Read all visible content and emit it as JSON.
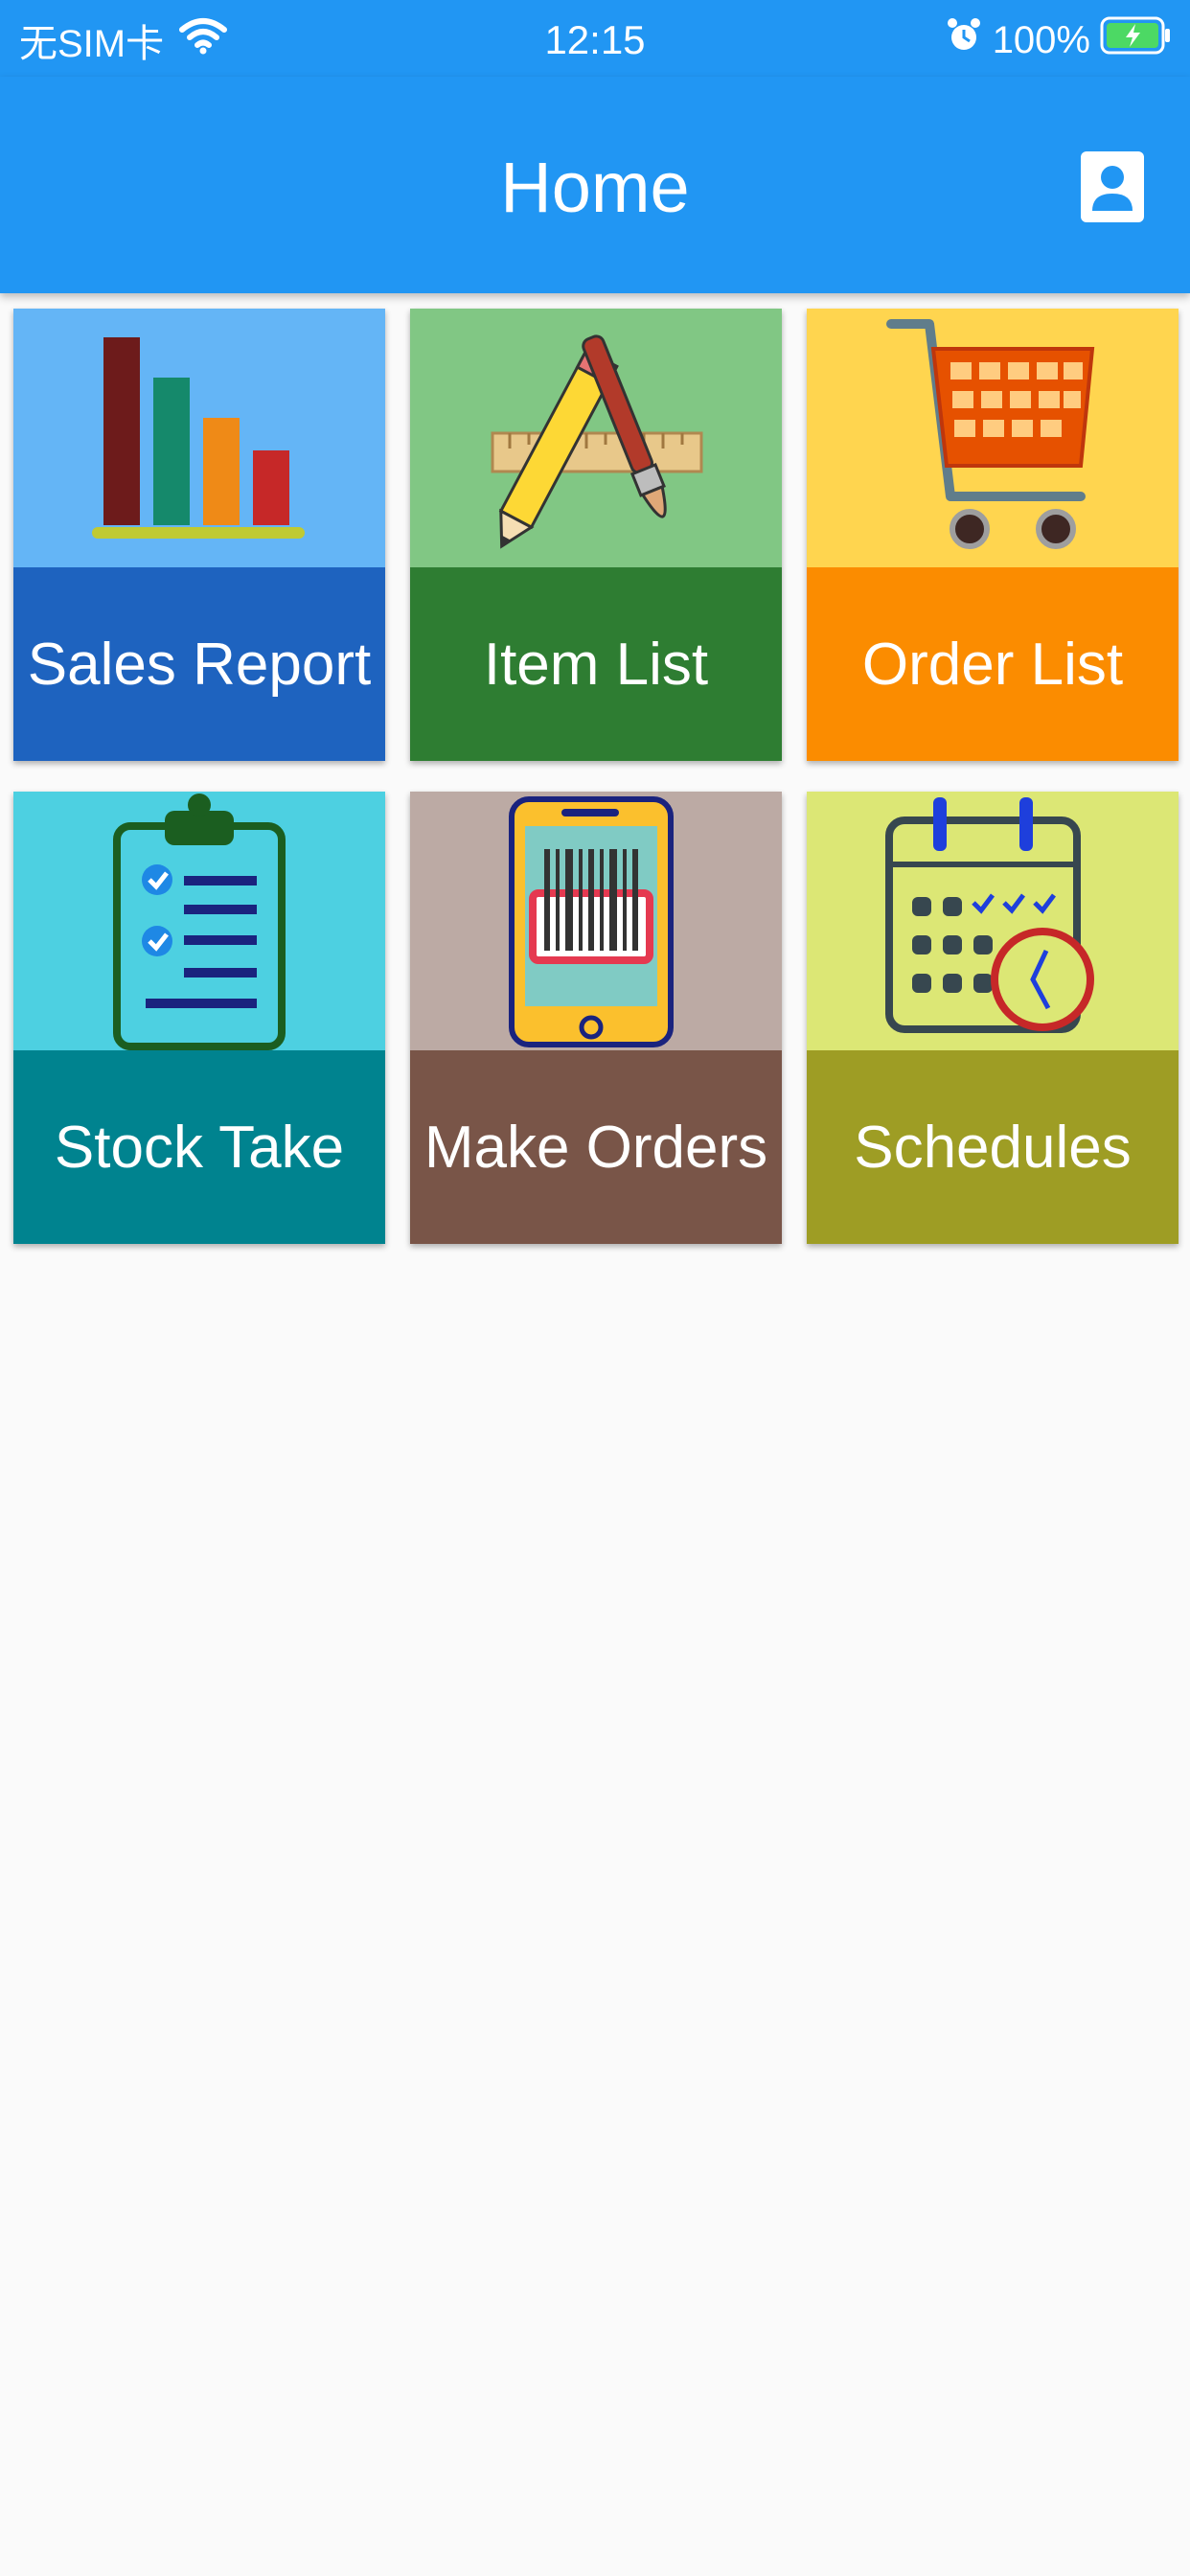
{
  "status_bar": {
    "carrier": "无SIM卡",
    "time": "12:15",
    "battery": "100%"
  },
  "app_bar": {
    "title": "Home"
  },
  "tiles": [
    {
      "label": "Sales Report",
      "art_color": "#64b5f6",
      "label_color": "#1e63bf",
      "icon": "bar-chart-icon"
    },
    {
      "label": "Item List",
      "art_color": "#81c784",
      "label_color": "#2e7d32",
      "icon": "pencil-ruler-brush-icon"
    },
    {
      "label": "Order List",
      "art_color": "#ffd54f",
      "label_color": "#fb8c00",
      "icon": "shopping-cart-icon"
    },
    {
      "label": "Stock Take",
      "art_color": "#4dd0e1",
      "label_color": "#00838f",
      "icon": "clipboard-checklist-icon"
    },
    {
      "label": "Make Orders",
      "art_color": "#bcaaa4",
      "label_color": "#795548",
      "icon": "phone-barcode-icon"
    },
    {
      "label": "Schedules",
      "art_color": "#dce775",
      "label_color": "#9e9d24",
      "icon": "calendar-clock-icon"
    }
  ]
}
